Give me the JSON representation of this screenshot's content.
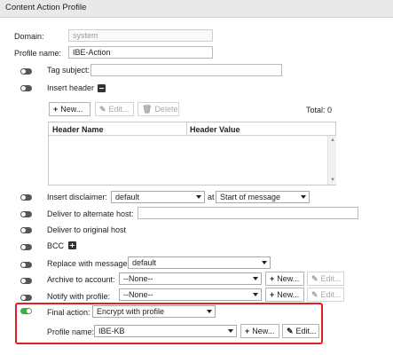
{
  "header": {
    "title": "Content Action Profile"
  },
  "domain": {
    "label": "Domain:",
    "value": "system"
  },
  "profile_name": {
    "label": "Profile name:",
    "value": "IBE-Action"
  },
  "tag_subject": {
    "label": "Tag subject:",
    "value": ""
  },
  "insert_header": {
    "label": "Insert header",
    "buttons": {
      "new": "New...",
      "edit": "Edit...",
      "delete": "Delete"
    },
    "total_label": "Total:",
    "total_value": "0",
    "columns": [
      "Header Name",
      "Header Value"
    ]
  },
  "insert_disclaimer": {
    "label": "Insert disclaimer:",
    "value": "default",
    "at_label": "at",
    "position": "Start of message"
  },
  "deliver_alternate": {
    "label": "Deliver to alternate host:",
    "value": ""
  },
  "deliver_original": {
    "label": "Deliver to original host"
  },
  "bcc": {
    "label": "BCC"
  },
  "replace_message": {
    "label": "Replace with message:",
    "value": "default"
  },
  "archive_account": {
    "label": "Archive to account:",
    "value": "--None--",
    "new": "New...",
    "edit": "Edit..."
  },
  "notify_profile": {
    "label": "Notify with profile:",
    "value": "--None--",
    "new": "New...",
    "edit": "Edit..."
  },
  "final_action": {
    "label": "Final action:",
    "value": "Encrypt with profile",
    "enabled": true
  },
  "enc_profile": {
    "label": "Profile name:",
    "value": "IBE-KB",
    "new": "New...",
    "edit": "Edit..."
  },
  "colors": {
    "toggle_on": "#3fae3f",
    "toggle_off": "#555555",
    "highlight": "#e02020"
  }
}
